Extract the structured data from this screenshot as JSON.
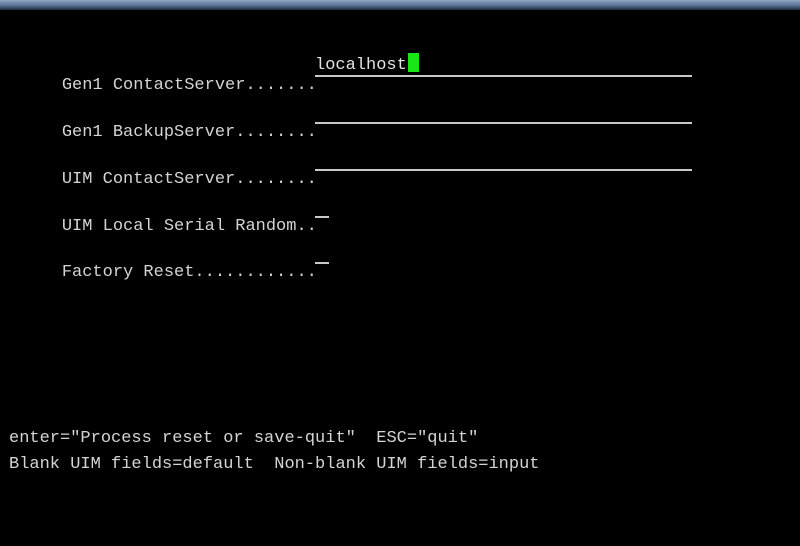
{
  "form": {
    "fields": [
      {
        "label": "Gen1 ContactServer.......",
        "value": "localhost"
      },
      {
        "label": "Gen1 BackupServer........",
        "value": ""
      },
      {
        "label": "UIM ContactServer........",
        "value": ""
      },
      {
        "label": "UIM Local Serial Random..",
        "value": ""
      },
      {
        "label": "Factory Reset............",
        "value": ""
      }
    ]
  },
  "help": {
    "line1": "enter=\"Process reset or save-quit\"  ESC=\"quit\"",
    "line2": "Blank UIM fields=default  Non-blank UIM fields=input"
  },
  "colors": {
    "background": "#000000",
    "text": "#d4d4d4",
    "cursor": "#19e619"
  }
}
